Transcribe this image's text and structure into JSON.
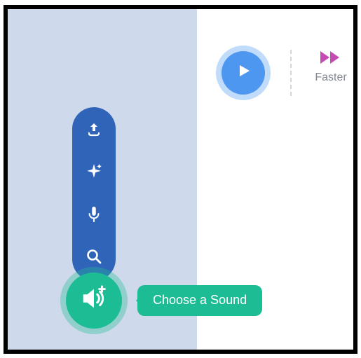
{
  "colors": {
    "pill": "#3064b8",
    "accent_green": "#1cbd94",
    "accent_blue": "#4d97f0",
    "faster_pink": "#c64bb3",
    "left_panel": "#cfd9ec"
  },
  "toolbar": {
    "items": [
      {
        "name": "upload-icon"
      },
      {
        "name": "sparkle-icon"
      },
      {
        "name": "microphone-icon"
      },
      {
        "name": "search-icon"
      }
    ]
  },
  "sound_button": {
    "tooltip": "Choose a Sound"
  },
  "play_button": {
    "label": "Play"
  },
  "speed": {
    "faster_label": "Faster"
  }
}
